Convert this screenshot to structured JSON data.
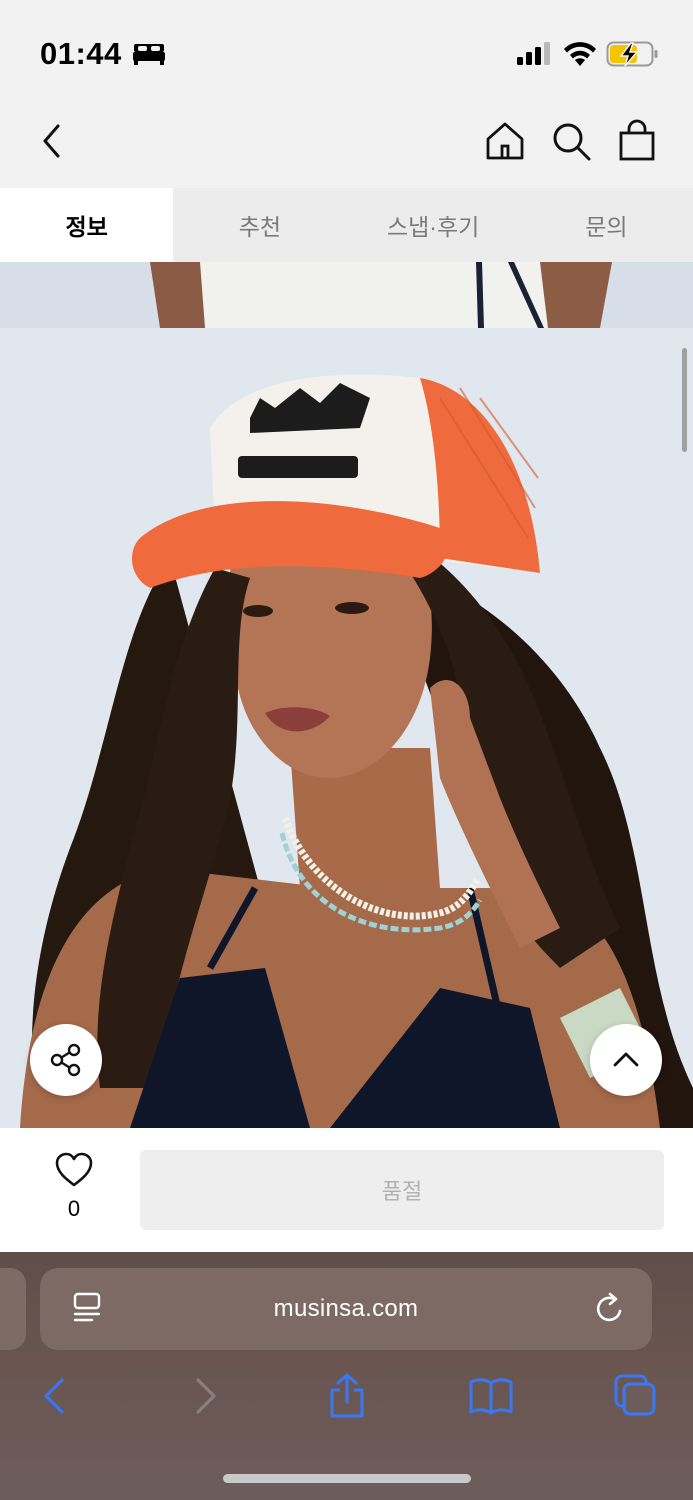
{
  "status_bar": {
    "time": "01:44",
    "icons": [
      "bed-icon",
      "cellular-signal-icon",
      "wifi-icon",
      "battery-charging-icon"
    ]
  },
  "nav": {
    "icons": [
      "back-chevron-icon",
      "home-icon",
      "search-icon",
      "shopping-bag-icon"
    ]
  },
  "tabs": [
    {
      "label": "정보",
      "active": true
    },
    {
      "label": "추천",
      "active": false
    },
    {
      "label": "스냅·후기",
      "active": false
    },
    {
      "label": "문의",
      "active": false
    }
  ],
  "product": {
    "floating_buttons": [
      "share-icon",
      "scroll-top-chevron-icon"
    ]
  },
  "action_bar": {
    "like_count": "0",
    "soldout_label": "품절"
  },
  "browser": {
    "url": "musinsa.com",
    "toolbar_icons": [
      "back-icon",
      "forward-icon",
      "share-icon",
      "bookmarks-icon",
      "tabs-icon"
    ]
  },
  "colors": {
    "cap_orange": "#ef6a3c",
    "accent_blue": "#3a78f2",
    "battery_yellow": "#f4c400"
  }
}
